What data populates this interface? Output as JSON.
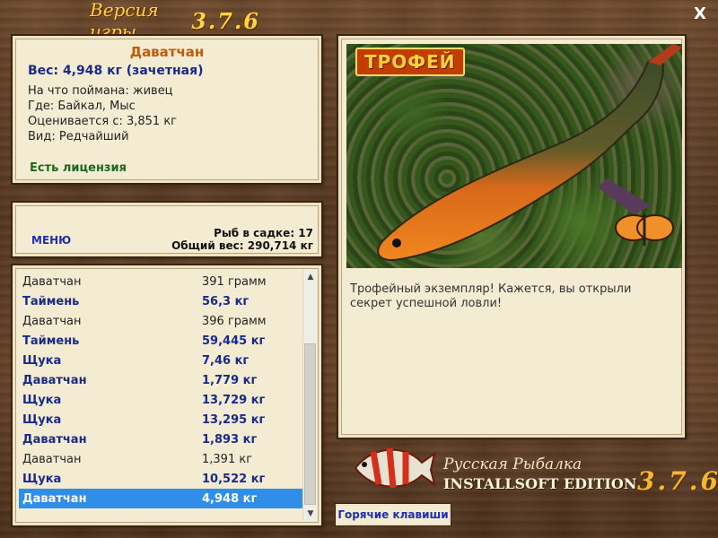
{
  "window": {
    "title": "Версия игры",
    "version": "3.7.6",
    "close_glyph": "X"
  },
  "catch_info": {
    "fish": "Даватчан",
    "weight": "Вес: 4,948 кг (зачетная)",
    "bait": "На что поймана: живец",
    "location": "Где: Байкал, Мыс",
    "valued_from": "Оценивается с: 3,851 кг",
    "rarity": "Вид: Редчайший",
    "license": "Есть лицензия"
  },
  "summary": {
    "menu_label": "МЕНЮ",
    "fish_in_cage": "Рыб в садке: 17",
    "total_weight": "Общий вес: 290,714 кг"
  },
  "catch_list": {
    "rows": [
      {
        "name": "Даватчан",
        "weight": "391 грамм",
        "bold": false
      },
      {
        "name": "Таймень",
        "weight": "56,3 кг",
        "bold": true
      },
      {
        "name": "Даватчан",
        "weight": "396 грамм",
        "bold": false
      },
      {
        "name": "Таймень",
        "weight": "59,445 кг",
        "bold": true
      },
      {
        "name": "Щука",
        "weight": "7,46 кг",
        "bold": true
      },
      {
        "name": "Даватчан",
        "weight": "1,779 кг",
        "bold": true
      },
      {
        "name": "Щука",
        "weight": "13,729 кг",
        "bold": true
      },
      {
        "name": "Щука",
        "weight": "13,295 кг",
        "bold": true
      },
      {
        "name": "Даватчан",
        "weight": "1,893 кг",
        "bold": true
      },
      {
        "name": "Даватчан",
        "weight": "1,391 кг",
        "bold": false
      },
      {
        "name": "Щука",
        "weight": "10,522 кг",
        "bold": true
      },
      {
        "name": "Даватчан",
        "weight": "4,948 кг",
        "bold": true,
        "selected": true
      }
    ],
    "selected_color": "#2f8fe8"
  },
  "trophy": {
    "badge": "ТРОФЕЙ",
    "description": "Трофейный экземпляр! Кажется, вы открыли секрет успешной ловли!"
  },
  "footer": {
    "hotkeys_label": "Горячие клавиши",
    "brand_name": "Русская Рыбалка",
    "edition": "INSTALLSOFT EDITION",
    "brand_version": "3.7.6"
  }
}
